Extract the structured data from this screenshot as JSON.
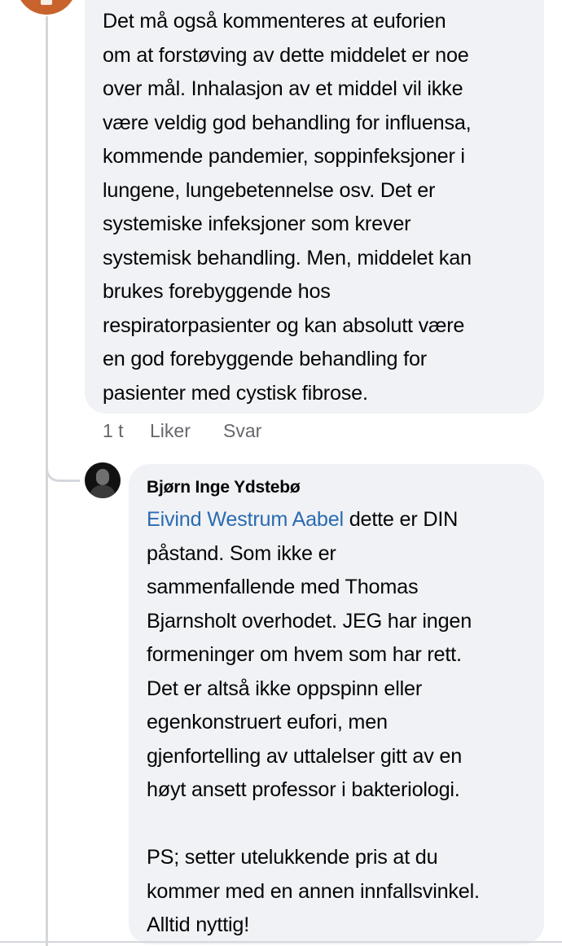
{
  "comment_1": {
    "text": "Det må også kommenteres at euforien\nom at forstøving av dette middelet er noe\nover mål. Inhalasjon av et middel vil ikke\nvære veldig god behandling for influensa,\nkommende pandemier, soppinfeksjoner i\nlungene, lungebetennelse osv. Det er\nsystemiske infeksjoner som krever\nsystemisk behandling. Men, middelet kan\nbrukes forebyggende hos\nrespiratorpasienter og kan absolutt være\nen god forebyggende behandling for\npasienter med cystisk fibrose.",
    "actions": {
      "time": "1 t",
      "like": "Liker",
      "reply": "Svar"
    }
  },
  "reply_1": {
    "author": "Bjørn Inge Ydstebø",
    "mention": "Eivind Westrum Aabel",
    "text": " dette er DIN\npåstand. Som ikke er\nsammenfallende med Thomas\nBjarnsholt overhodet. JEG har ingen\nformeninger om hvem som har rett.\nDet er altså ikke oppspinn eller\negenkonstruert eufori, men\ngjenfortelling av uttalelser gitt av en\nhøyt ansett professor i bakteriologi.\n\nPS; setter utelukkende pris at du\nkommer med en annen innfallsvinkel.\nAlltid nyttig!"
  },
  "colors": {
    "bubble_bg": "#f0f2f5",
    "mention": "#2a6bb0",
    "secondary_text": "#65676b",
    "thread_line": "#d4d7dc"
  }
}
